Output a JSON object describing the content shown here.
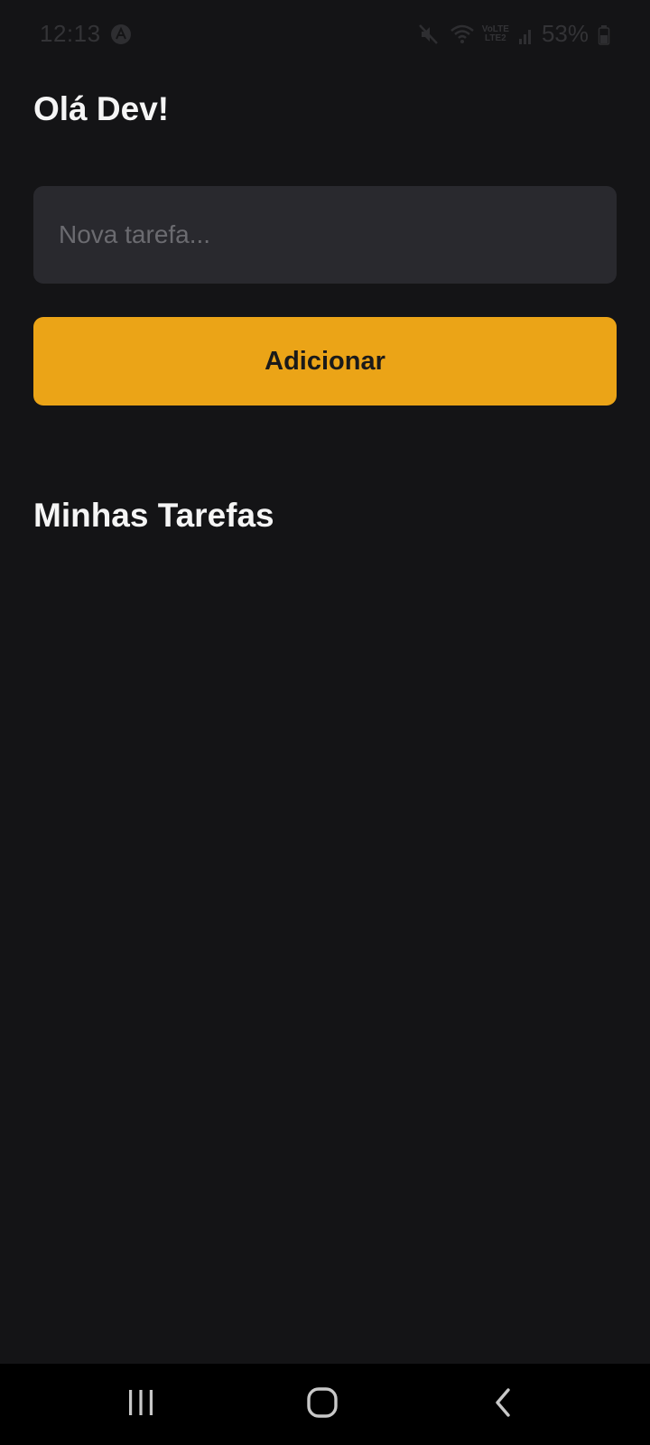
{
  "status_bar": {
    "time": "12:13",
    "volte_top": "VoLTE",
    "volte_bottom": "LTE2",
    "battery_text": "53%",
    "icons": [
      "app-a-icon",
      "mute-icon",
      "wifi-icon",
      "signal-icon",
      "battery-icon"
    ]
  },
  "header": {
    "greeting": "Olá Dev!"
  },
  "form": {
    "input_value": "",
    "input_placeholder": "Nova tarefa...",
    "add_button_label": "Adicionar"
  },
  "tasks": {
    "title": "Minhas Tarefas",
    "items": []
  },
  "colors": {
    "background": "#141416",
    "input_background": "#29292e",
    "accent": "#eba417",
    "text_primary": "#f5f5f5",
    "placeholder": "#6b6b70",
    "nav_background": "#000000"
  },
  "nav_bar": {
    "icons": [
      "recents-icon",
      "home-icon",
      "back-icon"
    ]
  }
}
